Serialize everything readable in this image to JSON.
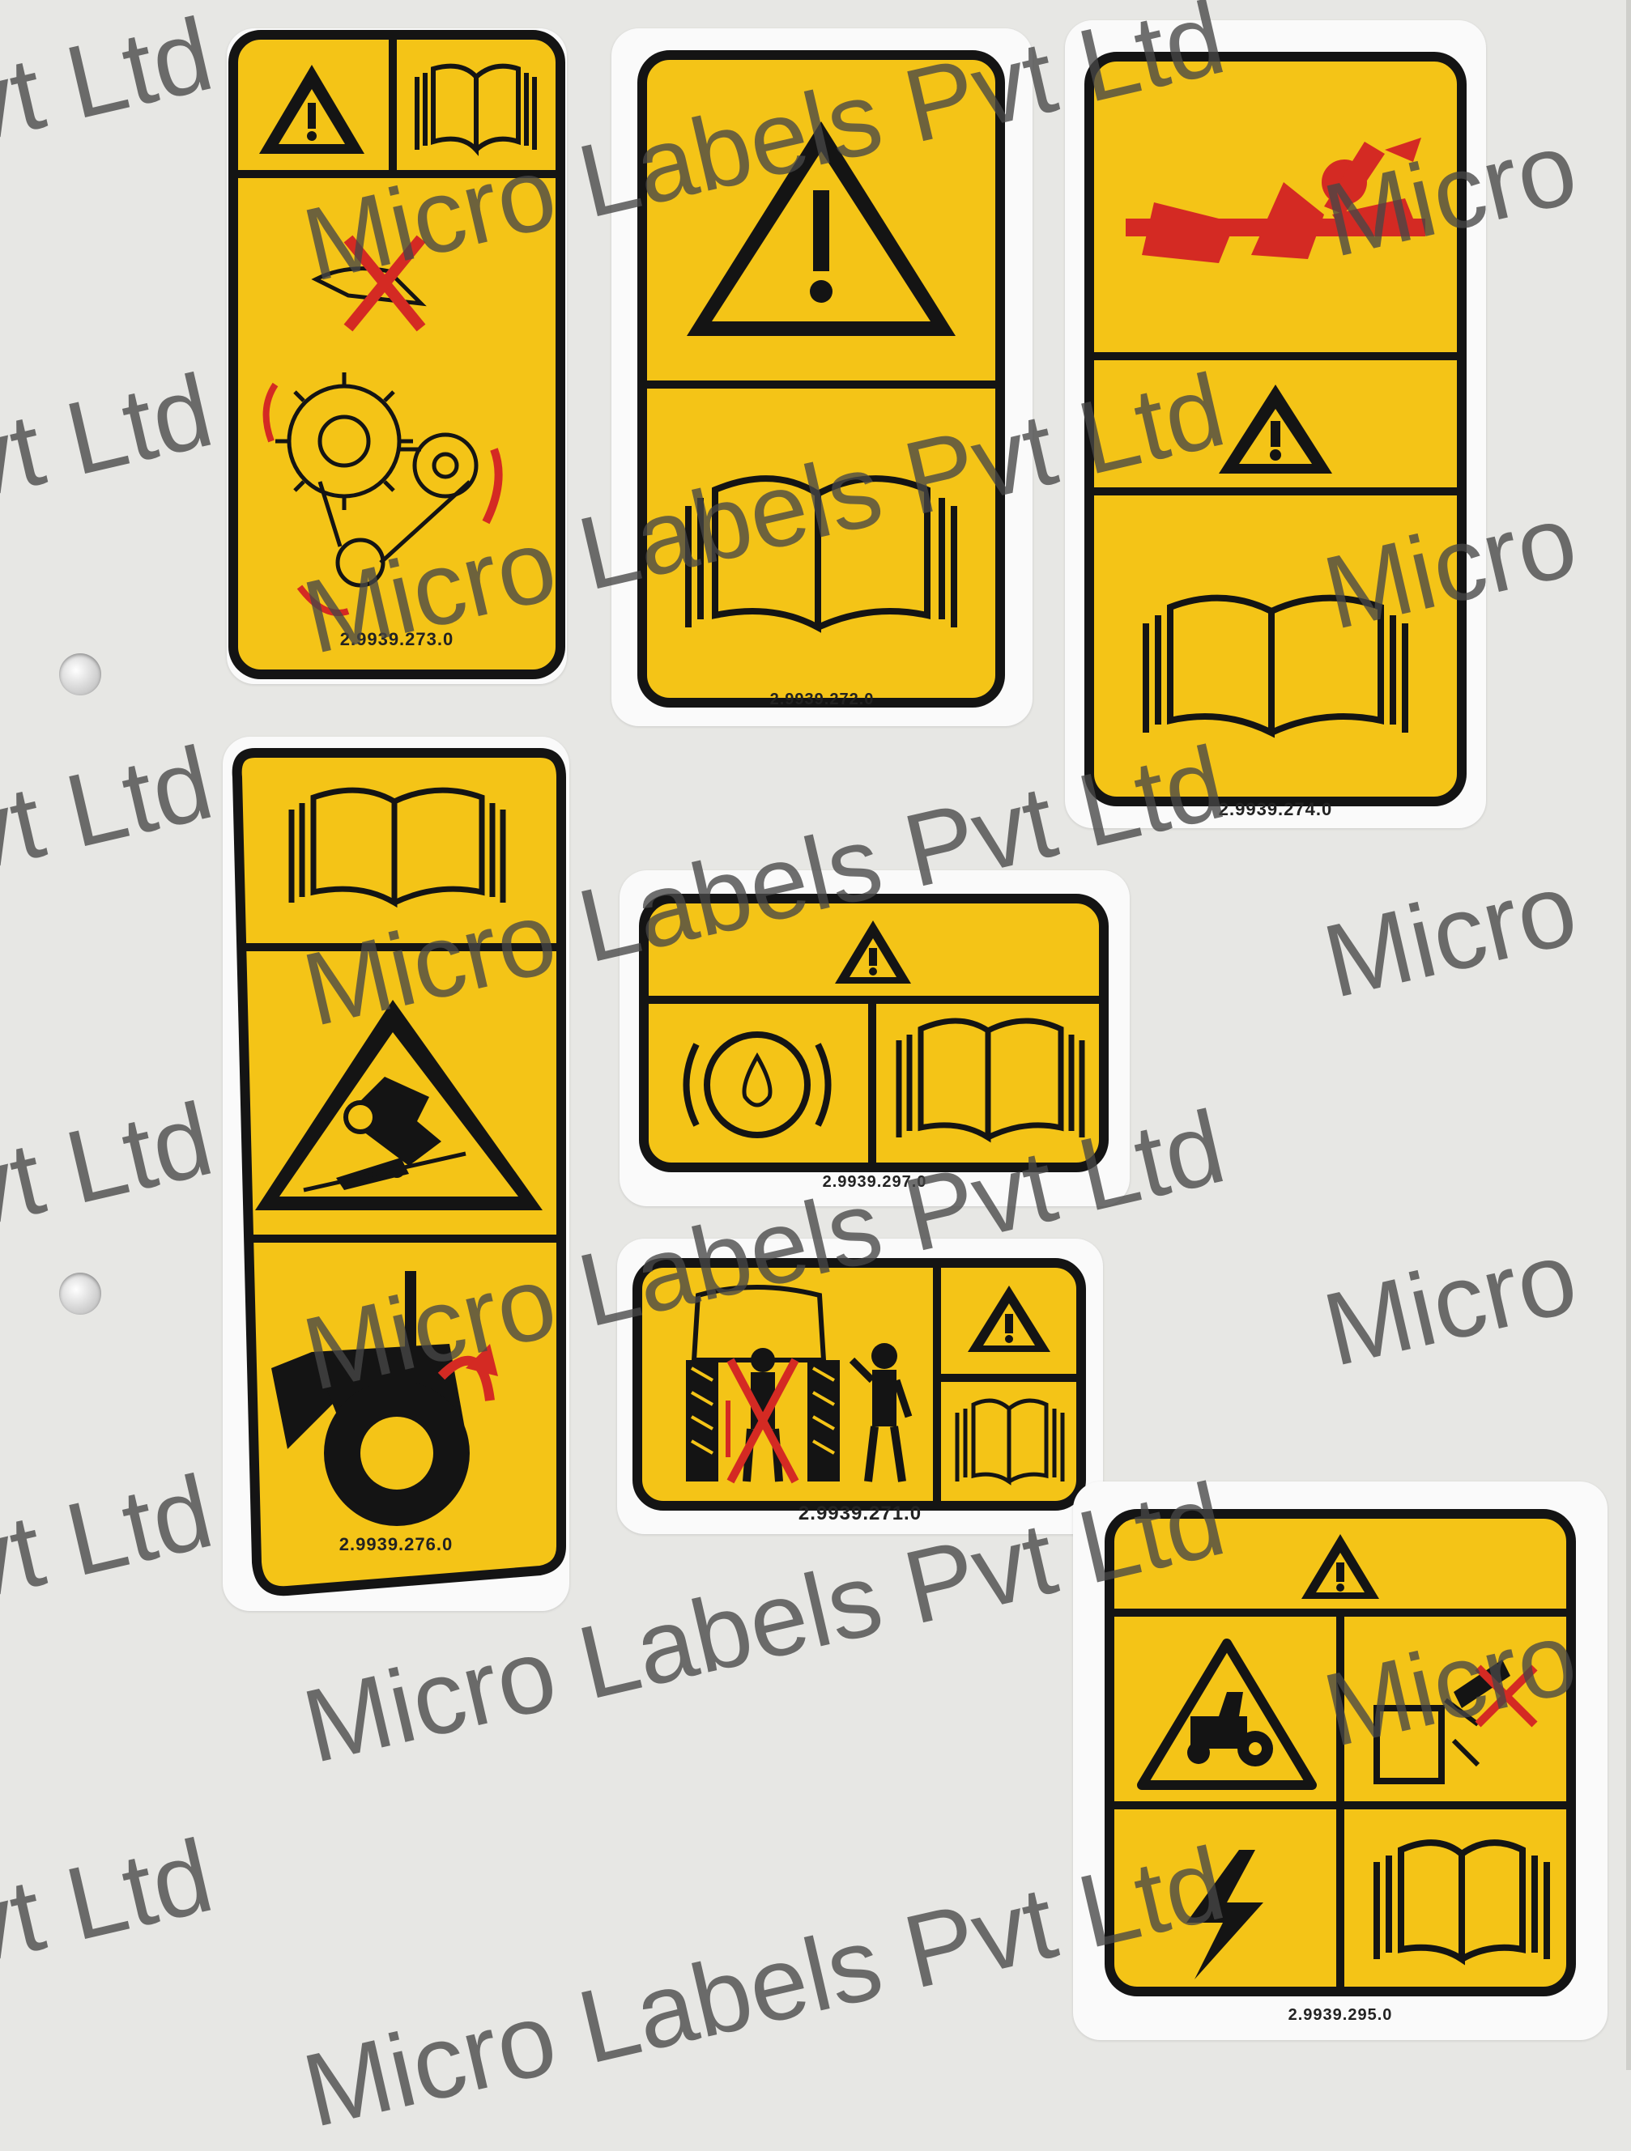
{
  "labels": [
    {
      "code": "2.9939.273.0"
    },
    {
      "code": "2.9939.272.0"
    },
    {
      "code": "2.9939.274.0"
    },
    {
      "code": "2.9939.276.0"
    },
    {
      "code": "2.9939.297.0"
    },
    {
      "code": "2.9939.271.0"
    },
    {
      "code": "2.9939.295.0"
    }
  ],
  "watermark": {
    "full": "Micro Labels Pvt Ltd",
    "partial_left": "vt Ltd",
    "partial_right": "Micro"
  },
  "colors": {
    "label_yellow": "#f4c417",
    "border_black": "#141414",
    "hazard_red": "#d42a23",
    "backing": "#fafafa",
    "sheet": "#e7e7e4"
  },
  "icons": [
    "warning-triangle-icon",
    "manual-book-icon",
    "fan-belt-icon",
    "entanglement-person-icon",
    "tractor-rollover-icon",
    "oil-pressure-icon",
    "lifting-person-icon",
    "tractor-hazard-icon",
    "high-voltage-icon"
  ]
}
